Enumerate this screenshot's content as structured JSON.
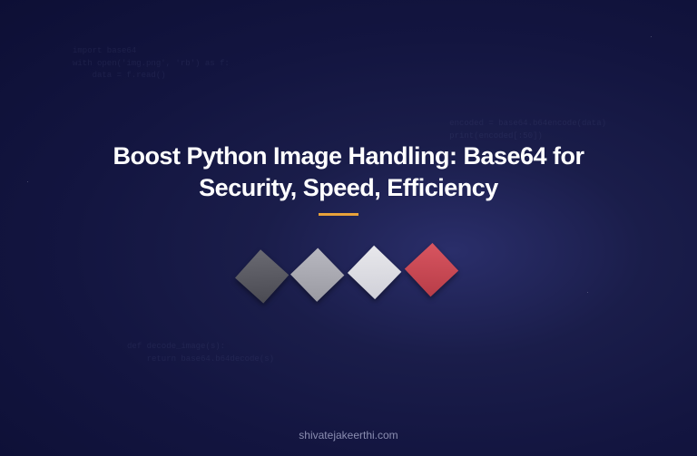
{
  "hero": {
    "title": "Boost Python Image Handling: Base64 for Security, Speed, Efficiency"
  },
  "footer": {
    "domain": "shivatejakeerthi.com"
  },
  "decoration": {
    "squares": [
      {
        "color": "gray-dark"
      },
      {
        "color": "gray-mid"
      },
      {
        "color": "gray-light"
      },
      {
        "color": "red"
      }
    ],
    "underline_color": "#e8a23a"
  },
  "code_snippets": {
    "snippet1": "import base64\nwith open('img.png', 'rb') as f:\n    data = f.read()",
    "snippet2": "encoded = base64.b64encode(data)\nprint(encoded[:50])",
    "snippet3": "def decode_image(s):\n    return base64.b64decode(s)"
  }
}
